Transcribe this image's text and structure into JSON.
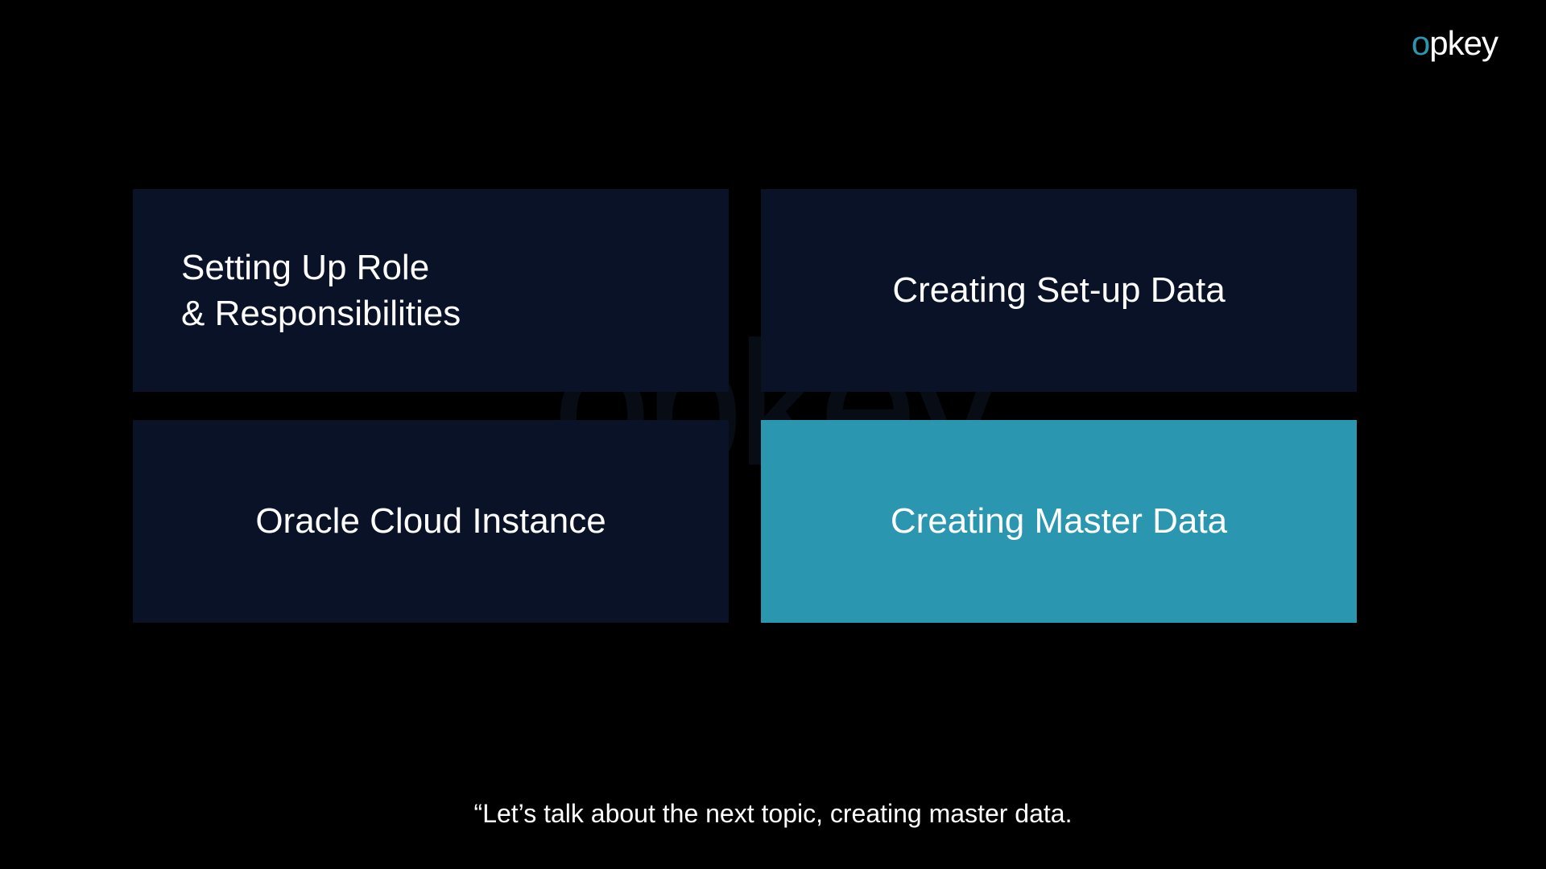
{
  "logo": {
    "accent_char": "o",
    "rest": "pkey"
  },
  "watermark": "opkey",
  "tiles": [
    {
      "label": "Setting Up Role\n& Responsibilities",
      "active": false,
      "align": "left"
    },
    {
      "label": "Creating Set-up Data",
      "active": false,
      "align": "center"
    },
    {
      "label": "Oracle Cloud Instance",
      "active": false,
      "align": "center"
    },
    {
      "label": "Creating Master Data",
      "active": true,
      "align": "center"
    }
  ],
  "caption": "“Let’s talk about the next topic, creating master data."
}
